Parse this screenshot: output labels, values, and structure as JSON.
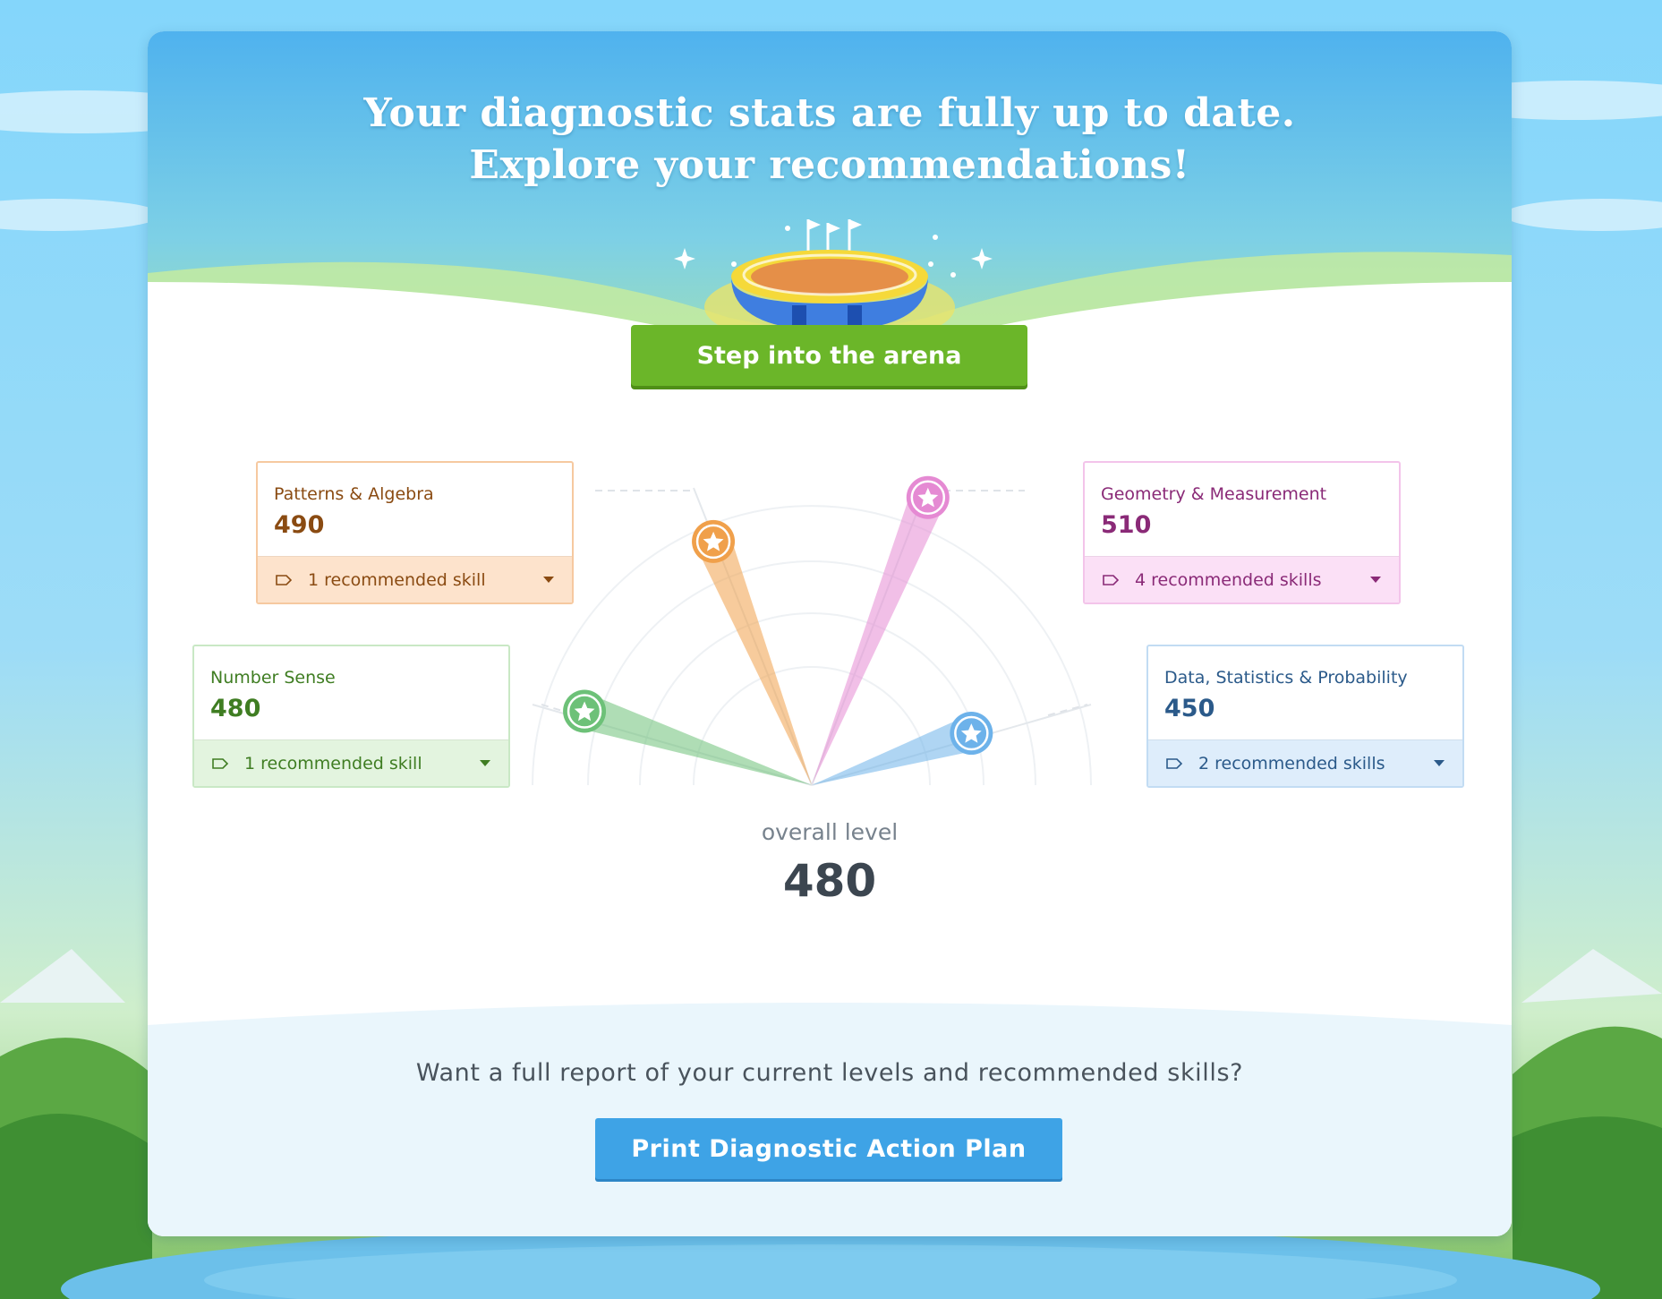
{
  "header": {
    "line1": "Your diagnostic stats are fully up to date.",
    "line2": "Explore your recommendations!",
    "arena_button": "Step into the arena"
  },
  "strands": [
    {
      "name": "Patterns & Algebra",
      "score": "490",
      "recommendation": "1 recommended skill",
      "color": "#f0a04b",
      "text_color": "#8a4b12",
      "bg": "#fde3cc",
      "border": "#f6c9a0"
    },
    {
      "name": "Geometry & Measurement",
      "score": "510",
      "recommendation": "4 recommended skills",
      "color": "#e58ad3",
      "text_color": "#8a2a77",
      "bg": "#fbe0f6",
      "border": "#f3c4ea"
    },
    {
      "name": "Number Sense",
      "score": "480",
      "recommendation": "1 recommended skill",
      "color": "#6dc178",
      "text_color": "#3f7d22",
      "bg": "#e3f4df",
      "border": "#c9e8c5"
    },
    {
      "name": "Data, Statistics & Probability",
      "score": "450",
      "recommendation": "2 recommended skills",
      "color": "#6db2ea",
      "text_color": "#2b5a8a",
      "bg": "#deedfb",
      "border": "#c2dcf3"
    }
  ],
  "overall": {
    "label": "overall level",
    "value": "480"
  },
  "footer": {
    "question": "Want a full report of your current levels and recommended skills?",
    "print_button": "Print Diagnostic Action Plan"
  },
  "icons": {
    "star": "star-icon",
    "tag": "tag-icon",
    "caret": "caret-down-icon",
    "arena": "arena-illustration"
  }
}
